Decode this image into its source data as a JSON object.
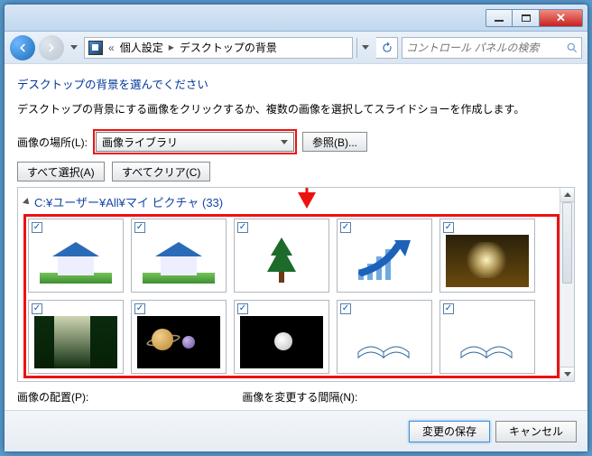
{
  "breadcrumb": {
    "root_chevron": "«",
    "item1": "個人設定",
    "sep": "▶",
    "item2": "デスクトップの背景"
  },
  "search": {
    "placeholder": "コントロール パネルの検索"
  },
  "heading": "デスクトップの背景を選んでください",
  "description": "デスクトップの背景にする画像をクリックするか、複数の画像を選択してスライドショーを作成します。",
  "location": {
    "label": "画像の場所(L):",
    "selected": "画像ライブラリ",
    "browse": "参照(B)..."
  },
  "buttons": {
    "select_all": "すべて選択(A)",
    "clear_all": "すべてクリア(C)"
  },
  "folder": {
    "path_prefix": "C:¥ユーザー¥All¥マイ ピクチャ (",
    "count": 33,
    "path_suffix": ")"
  },
  "labels": {
    "position": "画像の配置(P):",
    "interval": "画像を変更する間隔(N):"
  },
  "footer": {
    "save": "変更の保存",
    "cancel": "キャンセル"
  },
  "thumbnails": [
    {
      "checked": true,
      "kind": "house"
    },
    {
      "checked": true,
      "kind": "house"
    },
    {
      "checked": true,
      "kind": "tree"
    },
    {
      "checked": true,
      "kind": "arrow"
    },
    {
      "checked": true,
      "kind": "photo1"
    },
    {
      "checked": true,
      "kind": "forest"
    },
    {
      "checked": true,
      "kind": "planets"
    },
    {
      "checked": true,
      "kind": "moon"
    },
    {
      "checked": true,
      "kind": "book"
    },
    {
      "checked": true,
      "kind": "book"
    }
  ]
}
